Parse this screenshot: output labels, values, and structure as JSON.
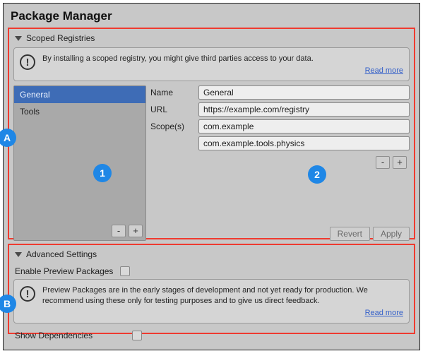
{
  "title": "Package Manager",
  "markers": {
    "A": "A",
    "B": "B",
    "one": "1",
    "two": "2"
  },
  "scoped": {
    "header": "Scoped Registries",
    "info_text": "By installing a scoped registry, you might give third parties access to your data.",
    "info_link": "Read more",
    "registries": [
      {
        "label": "General",
        "selected": true
      },
      {
        "label": "Tools",
        "selected": false
      }
    ],
    "list_minus": "-",
    "list_plus": "+",
    "fields": {
      "name_label": "Name",
      "name_value": "General",
      "url_label": "URL",
      "url_value": "https://example.com/registry",
      "scopes_label": "Scope(s)",
      "scope1": "com.example",
      "scope2": "com.example.tools.physics"
    },
    "scope_minus": "-",
    "scope_plus": "+",
    "revert": "Revert",
    "apply": "Apply"
  },
  "advanced": {
    "header": "Advanced Settings",
    "enable_preview": "Enable Preview Packages",
    "info_text": "Preview Packages are in the early stages of development and not yet ready for production. We recommend using these only for testing purposes and to give us direct feedback.",
    "info_link": "Read more",
    "show_deps": "Show Dependencies"
  }
}
